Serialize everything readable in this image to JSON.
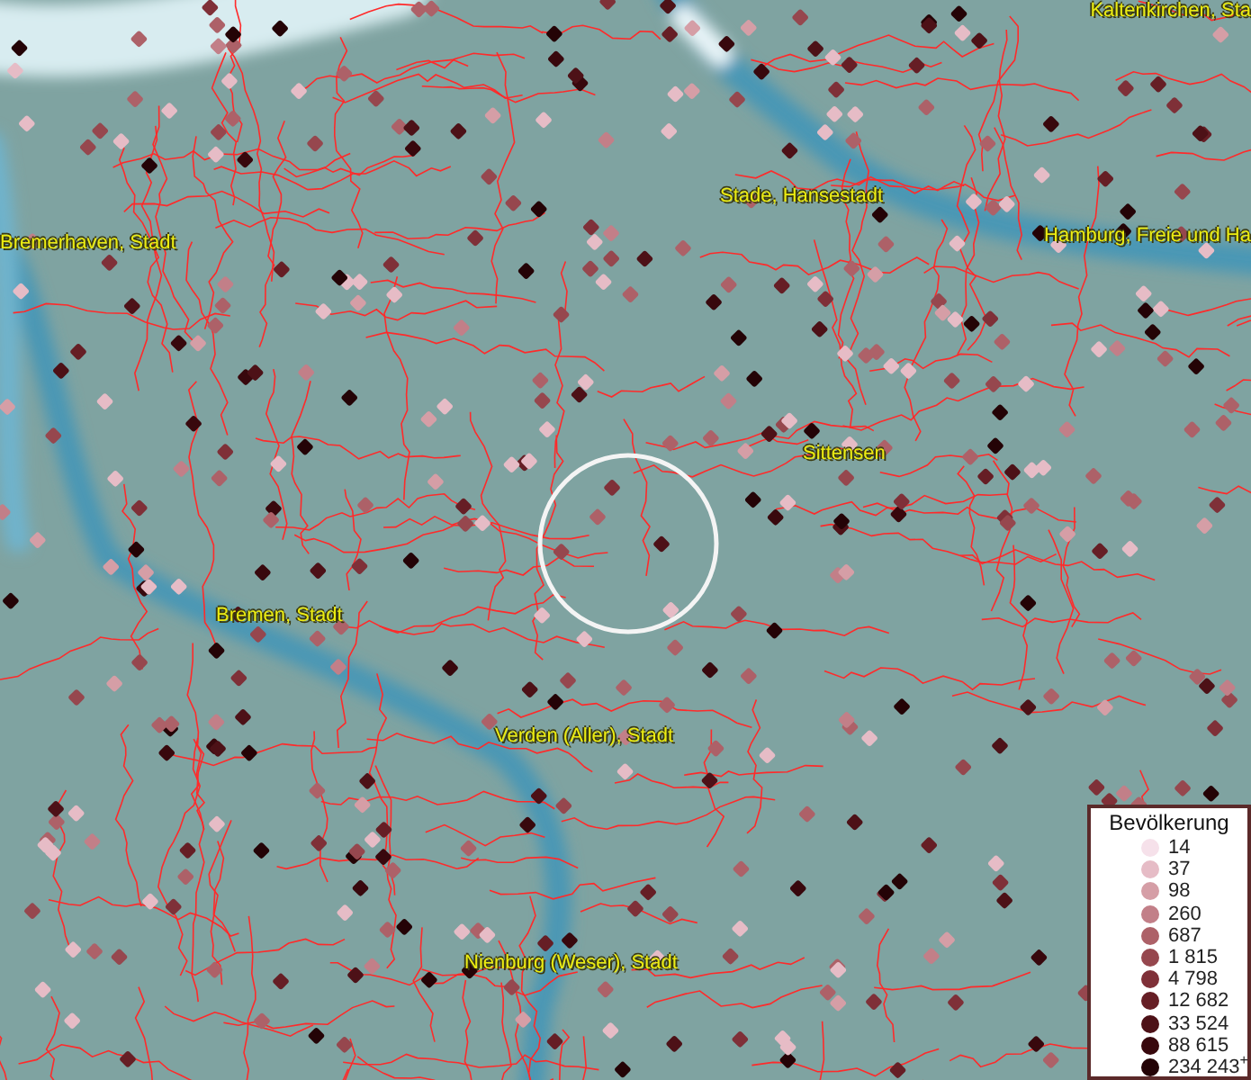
{
  "map": {
    "places": [
      {
        "label": "Kaltenkirchen, Sta"
      },
      {
        "label": "Stade, Hansestadt"
      },
      {
        "label": "Bremerhaven, Stadt"
      },
      {
        "label": "Hamburg, Freie und Ha"
      },
      {
        "label": "Sittensen"
      },
      {
        "label": "Bremen, Stadt"
      },
      {
        "label": "Verden (Aller), Stadt"
      },
      {
        "label": "Nienburg (Weser), Stadt"
      }
    ]
  },
  "legend": {
    "title": "Bevölkerung",
    "items": [
      {
        "label": "14",
        "color": "#f6e1ea"
      },
      {
        "label": "37",
        "color": "#e6bcc6"
      },
      {
        "label": "98",
        "color": "#d59ea6"
      },
      {
        "label": "260",
        "color": "#c27f88"
      },
      {
        "label": "687",
        "color": "#ad6168"
      },
      {
        "label": "1 815",
        "color": "#96474e"
      },
      {
        "label": "4 798",
        "color": "#7f3038"
      },
      {
        "label": "12 682",
        "color": "#661e25"
      },
      {
        "label": "33 524",
        "color": "#4d1117"
      },
      {
        "label": "88 615",
        "color": "#38080d"
      },
      {
        "label": "234 243$^{+}$",
        "color": "#240306"
      }
    ]
  }
}
